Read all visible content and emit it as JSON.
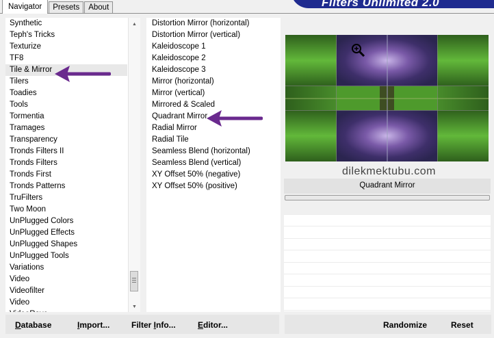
{
  "tabs": [
    {
      "label": "Navigator",
      "active": true
    },
    {
      "label": "Presets",
      "active": false
    },
    {
      "label": "About",
      "active": false
    }
  ],
  "banner_text": "Filters Unlimited 2.0",
  "categories": [
    {
      "label": "Synthetic",
      "selected": false
    },
    {
      "label": "Teph's Tricks",
      "selected": false
    },
    {
      "label": "Texturize",
      "selected": false
    },
    {
      "label": "TF8",
      "selected": false
    },
    {
      "label": "Tile & Mirror",
      "selected": true
    },
    {
      "label": "Tilers",
      "selected": false
    },
    {
      "label": "Toadies",
      "selected": false
    },
    {
      "label": "Tools",
      "selected": false
    },
    {
      "label": "Tormentia",
      "selected": false
    },
    {
      "label": "Tramages",
      "selected": false
    },
    {
      "label": "Transparency",
      "selected": false
    },
    {
      "label": "Tronds Filters II",
      "selected": false
    },
    {
      "label": "Tronds Filters",
      "selected": false
    },
    {
      "label": "Tronds First",
      "selected": false
    },
    {
      "label": "Tronds Patterns",
      "selected": false
    },
    {
      "label": "TruFilters",
      "selected": false
    },
    {
      "label": "Two Moon",
      "selected": false
    },
    {
      "label": "UnPlugged Colors",
      "selected": false
    },
    {
      "label": "UnPlugged Effects",
      "selected": false
    },
    {
      "label": "UnPlugged Shapes",
      "selected": false
    },
    {
      "label": "UnPlugged Tools",
      "selected": false
    },
    {
      "label": "Variations",
      "selected": false
    },
    {
      "label": "Video",
      "selected": false
    },
    {
      "label": "Videofilter",
      "selected": false
    },
    {
      "label": "Video",
      "selected": false
    },
    {
      "label": "VideoRave",
      "selected": false
    }
  ],
  "filters": [
    "Distortion Mirror (horizontal)",
    "Distortion Mirror (vertical)",
    "Kaleidoscope 1",
    "Kaleidoscope 2",
    "Kaleidoscope 3",
    "Mirror (horizontal)",
    "Mirror (vertical)",
    "Mirrored & Scaled",
    "Quadrant Mirror",
    "Radial Mirror",
    "Radial Tile",
    "Seamless Blend (horizontal)",
    "Seamless Blend (vertical)",
    "XY Offset 50% (negative)",
    "XY Offset 50% (positive)"
  ],
  "selected_filter": "Quadrant Mirror",
  "watermark": "dilekmektubu.com",
  "buttons": {
    "database": {
      "label": "Database",
      "underline": "D",
      "rest": "atabase"
    },
    "import": {
      "label": "Import...",
      "underline": "I",
      "rest": "mport..."
    },
    "filter_info": {
      "label": "Filter Info...",
      "prefix": "Filter ",
      "underline": "I",
      "rest": "nfo..."
    },
    "editor": {
      "label": "Editor...",
      "underline": "E",
      "rest": "ditor..."
    },
    "randomize": "Randomize",
    "reset": "Reset"
  },
  "colors": {
    "accent_arrow": "#6a2a8e",
    "banner": "#1f2b8f",
    "preview_green": "#3f8a22",
    "preview_purple": "#6a4aa0"
  },
  "icons": [
    "zoom-icon",
    "scroll-up-icon",
    "scroll-down-icon",
    "arrow-pointer-icon"
  ]
}
